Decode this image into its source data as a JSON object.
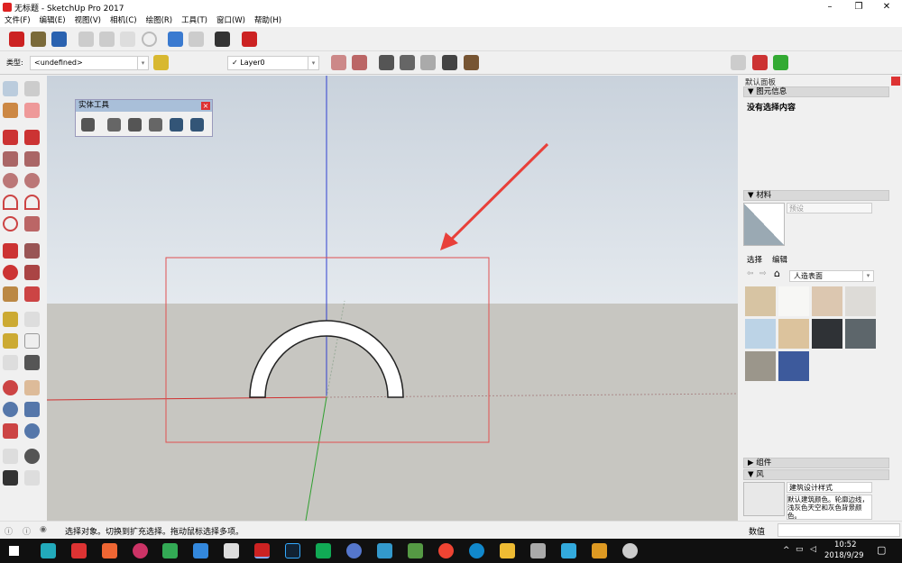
{
  "window": {
    "title": "无标题 - SketchUp Pro 2017",
    "minimize": "–",
    "maximize": "❐",
    "close": "✕"
  },
  "menu": [
    "文件(F)",
    "编辑(E)",
    "视图(V)",
    "相机(C)",
    "绘图(R)",
    "工具(T)",
    "窗口(W)",
    "帮助(H)"
  ],
  "toolbar2": {
    "type_label": "类型:",
    "type_value": "<undefined>",
    "layer_check": "✓",
    "layer_value": "Layer0"
  },
  "solid_tools": {
    "title": "实体工具",
    "close": "×"
  },
  "panel": {
    "title": "默认面板",
    "entity_info": {
      "header": "▼ 图元信息",
      "content": "没有选择内容"
    },
    "materials": {
      "header": "▼ 材料",
      "name_placeholder": "预设",
      "tab_select": "选择",
      "tab_edit": "编辑",
      "library": "人造表面",
      "swatches": [
        "#d7c4a3",
        "#f7f7f5",
        "#dcc7b0",
        "#dddbd7",
        "#bcd3e6",
        "#dcc39d",
        "#2f3236",
        "#5d666b",
        "#9b968b",
        "#3d5a9c"
      ]
    },
    "components": {
      "header": "▶ 组件"
    },
    "styles": {
      "header": "▼ 风",
      "style_name": "建筑设计样式",
      "style_desc": "默认建筑颜色。轮廓边线，浅灰色天空和灰色背景颜色。"
    },
    "measurements_label": "数值"
  },
  "status": {
    "text": "选择对象。切换到扩充选择。拖动鼠标选择多项。"
  },
  "taskbar": {
    "time": "10:52",
    "date": "2018/9/29"
  },
  "colors": {
    "selection_rect": "#e05050",
    "arrow": "#e8403a",
    "axis_red": "#d03030",
    "axis_blue": "#3040d0",
    "axis_green": "#30a030"
  }
}
